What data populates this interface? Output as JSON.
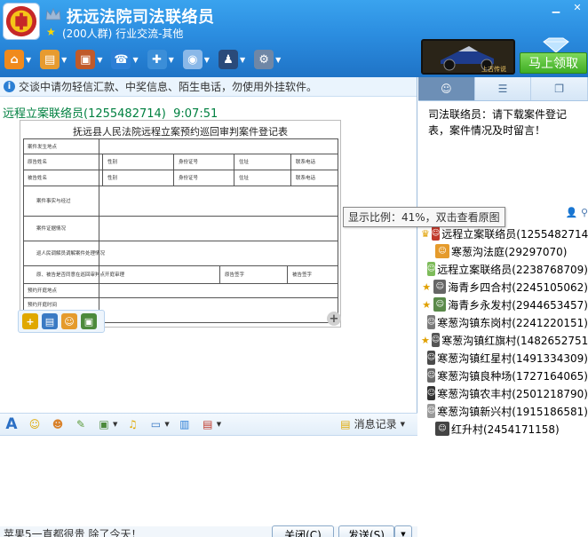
{
  "window": {
    "title": "抚远法院司法联络员",
    "subtitle": "(200人群) 行业交流-其他",
    "controls": [
      "▁",
      "✕"
    ]
  },
  "toolbar": {
    "items": [
      {
        "name": "home",
        "glyph": "⌂",
        "color": "#f08a1c"
      },
      {
        "name": "share",
        "glyph": "▤",
        "color": "#e79b2f"
      },
      {
        "name": "album",
        "glyph": "▣",
        "color": "#c05a2a"
      },
      {
        "name": "voice",
        "glyph": "☎",
        "color": "#2d7fd6"
      },
      {
        "name": "board",
        "glyph": "✚",
        "color": "#3b8ed8"
      },
      {
        "name": "video",
        "glyph": "◉",
        "color": "#8ab8e8"
      },
      {
        "name": "member",
        "glyph": "♟",
        "color": "#2a4a7a"
      },
      {
        "name": "settings",
        "glyph": "⚙",
        "color": "#6f87a6"
      }
    ]
  },
  "promo": {
    "ad_caption": "上古传说",
    "claim_label": "马上领取"
  },
  "chat": {
    "notice": "交谈中请勿轻信汇款、中奖信息、陌生电话，勿使用外挂软件。",
    "message_sender": "远程立案联络员(1255482714)",
    "message_time": "9:07:51",
    "image": {
      "title": "抚远县人民法院远程立案预约巡回审判案件登记表",
      "table_rows": [
        {
          "label": "案件发生地点",
          "cells": []
        },
        {
          "label": "原告姓名",
          "cells": [
            "性别",
            "身份证号",
            "住址",
            "联系电话"
          ]
        },
        {
          "label": "被告姓名",
          "cells": [
            "性别",
            "身份证号",
            "住址",
            "联系电话"
          ]
        },
        {
          "label": "案件事实与经过",
          "cells": []
        },
        {
          "label": "案件证据情况",
          "cells": []
        },
        {
          "label": "巡人民调解员调解案件处理情况",
          "cells": []
        },
        {
          "label": "原、被告是否同意在巡回审判点开庭审理",
          "cells": [
            "原告签字",
            "被告签字"
          ]
        },
        {
          "label": "预约开庭地点",
          "cells": []
        },
        {
          "label": "预约开庭时间",
          "cells": []
        }
      ]
    },
    "tooltip": "显示比例：41%，双击查看原图",
    "message_history_label": "消息记录",
    "draft_text": "苹果5一直都很贵 除了今天！",
    "close_label": "关闭(C)",
    "send_label": "发送(S)"
  },
  "edit_toolbar": {
    "items": [
      {
        "name": "font",
        "glyph": "A",
        "color": "#2b6fc4"
      },
      {
        "name": "emoji",
        "glyph": "☺",
        "color": "#e0a800"
      },
      {
        "name": "magic-emoji",
        "glyph": "☻",
        "color": "#d9822b"
      },
      {
        "name": "doodle",
        "glyph": "✎",
        "color": "#5a9a3a"
      },
      {
        "name": "image",
        "glyph": "▣",
        "color": "#4c8a3c"
      },
      {
        "name": "music",
        "glyph": "♫",
        "color": "#e0a800"
      },
      {
        "name": "screenshot",
        "glyph": "▭",
        "color": "#3a7ac4"
      },
      {
        "name": "vote",
        "glyph": "▥",
        "color": "#2d7fd6"
      },
      {
        "name": "more",
        "glyph": "▤",
        "color": "#c0392b"
      }
    ]
  },
  "sidebar": {
    "tabs": [
      {
        "name": "members",
        "glyph": "☺"
      },
      {
        "name": "list",
        "glyph": "☰"
      },
      {
        "name": "window",
        "glyph": "❐"
      }
    ],
    "announcement": "司法联络员：请下载案件登记表，案件情况及时留言！",
    "members": [
      {
        "badge": "♛",
        "badge_color": "#e0a000",
        "avatar_color": "#c0392b",
        "name": "远程立案联络员(1255482714)"
      },
      {
        "badge": "",
        "badge_color": "",
        "avatar_color": "#e59b2c",
        "name": "寒葱沟法庭(29297070)"
      },
      {
        "badge": "",
        "badge_color": "",
        "avatar_color": "#7dbb5a",
        "name": "远程立案联络员(2238768709)"
      },
      {
        "badge": "★",
        "badge_color": "#e0a000",
        "avatar_color": "#666666",
        "name": "海青乡四合村(2245105062)"
      },
      {
        "badge": "★",
        "badge_color": "#e0a000",
        "avatar_color": "#5a8a4a",
        "name": "海青乡永发村(2944653457)"
      },
      {
        "badge": "",
        "badge_color": "",
        "avatar_color": "#7a7a7a",
        "name": "寒葱沟镇东岗村(2241220151)"
      },
      {
        "badge": "★",
        "badge_color": "#e0a000",
        "avatar_color": "#555555",
        "name": "寒葱沟镇红旗村(1482652751)"
      },
      {
        "badge": "",
        "badge_color": "",
        "avatar_color": "#4a4a4a",
        "name": "寒葱沟镇红星村(1491334309)"
      },
      {
        "badge": "",
        "badge_color": "",
        "avatar_color": "#6a6a6a",
        "name": "寒葱沟镇良种场(1727164065)"
      },
      {
        "badge": "",
        "badge_color": "",
        "avatar_color": "#333333",
        "name": "寒葱沟镇农丰村(2501218790)"
      },
      {
        "badge": "",
        "badge_color": "",
        "avatar_color": "#999999",
        "name": "寒葱沟镇新兴村(1915186581)"
      },
      {
        "badge": "",
        "badge_color": "",
        "avatar_color": "#444444",
        "name": "红升村(2454171158)"
      }
    ]
  }
}
